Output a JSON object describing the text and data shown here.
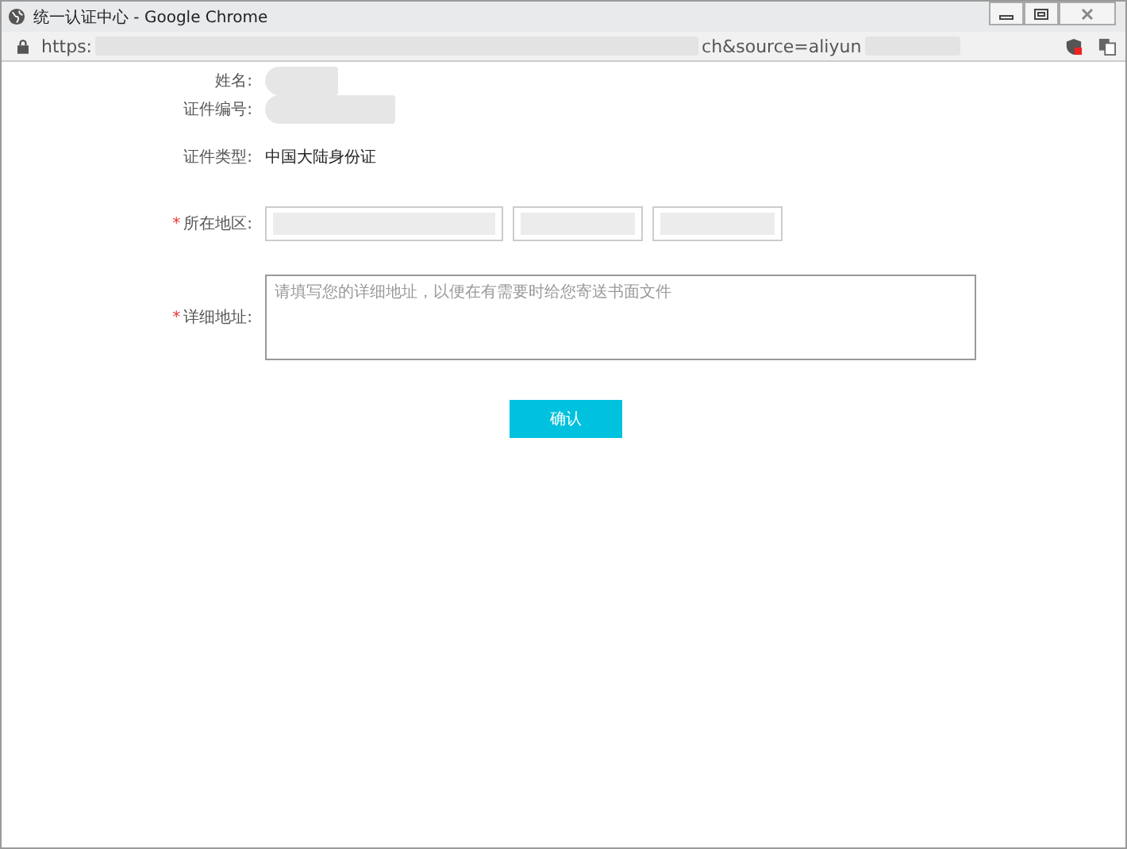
{
  "window": {
    "title": "统一认证中心 - Google Chrome"
  },
  "address_bar": {
    "url_parts": [
      "https:",
      "ch&source=aliyun"
    ]
  },
  "form": {
    "rows": [
      {
        "kind": "redacted_short",
        "label": "姓名:"
      },
      {
        "kind": "redacted_long",
        "label": "证件编号:"
      },
      {
        "kind": "text",
        "label": "证件类型:",
        "value": "中国大陆身份证"
      },
      {
        "kind": "selects",
        "label": "所在地区:",
        "mark": "*"
      },
      {
        "kind": "textarea",
        "label": "详细地址:",
        "mark": "*",
        "placeholder": "请填写您的详细地址，以便在有需要时给您寄送书面文件"
      }
    ],
    "submit": "确认"
  }
}
